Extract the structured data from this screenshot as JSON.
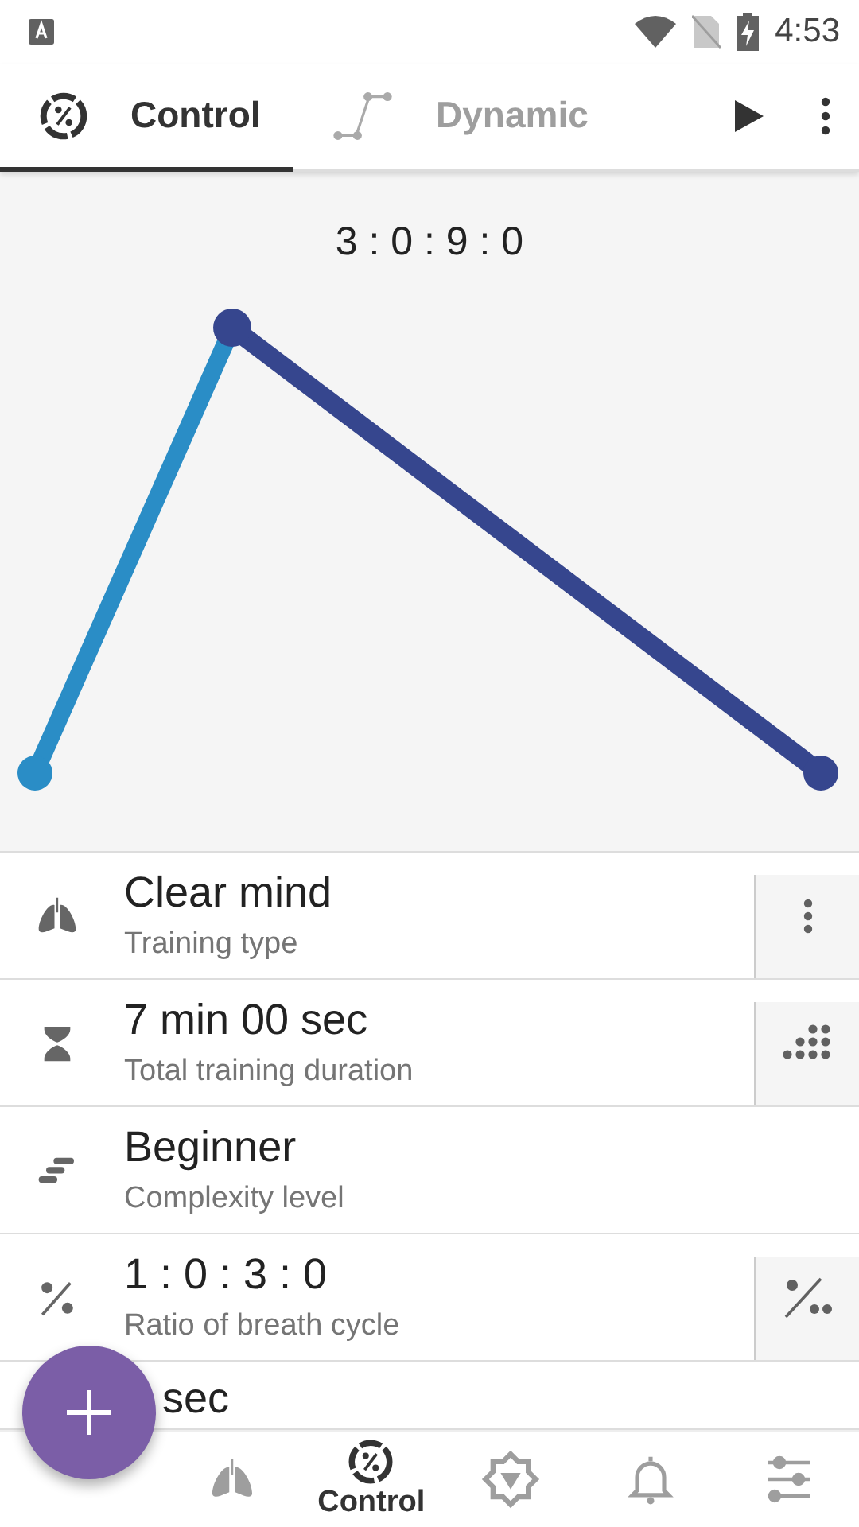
{
  "status_bar": {
    "time": "4:53"
  },
  "tabs": [
    {
      "label": "Control",
      "kind": "control",
      "selected": true
    },
    {
      "label": "Dynamic",
      "kind": "dynamic",
      "selected": false
    }
  ],
  "chart": {
    "ratio": "3 : 0 : 9 : 0"
  },
  "settings": [
    {
      "kind": "lungs",
      "title": "Clear mind",
      "subtitle": "Training type",
      "action": {
        "kind": "more"
      }
    },
    {
      "kind": "hourglass",
      "title": "7 min 00 sec",
      "subtitle": "Total training duration",
      "action": {
        "kind": "dots"
      }
    },
    {
      "kind": "level",
      "title": "Beginner",
      "subtitle": "Complexity level"
    },
    {
      "kind": "ratio",
      "title": "1 : 0 : 3 : 0",
      "subtitle": "Ratio of breath cycle",
      "action": {
        "kind": "ratio"
      }
    },
    {
      "kind": "none",
      "title": "sec"
    }
  ],
  "bottom_nav": [
    {
      "kind": "lungs",
      "selected": false
    },
    {
      "kind": "control",
      "label": "Control",
      "selected": true
    },
    {
      "kind": "chakra",
      "selected": false
    },
    {
      "kind": "bell",
      "selected": false
    },
    {
      "kind": "sliders",
      "selected": false
    }
  ]
}
